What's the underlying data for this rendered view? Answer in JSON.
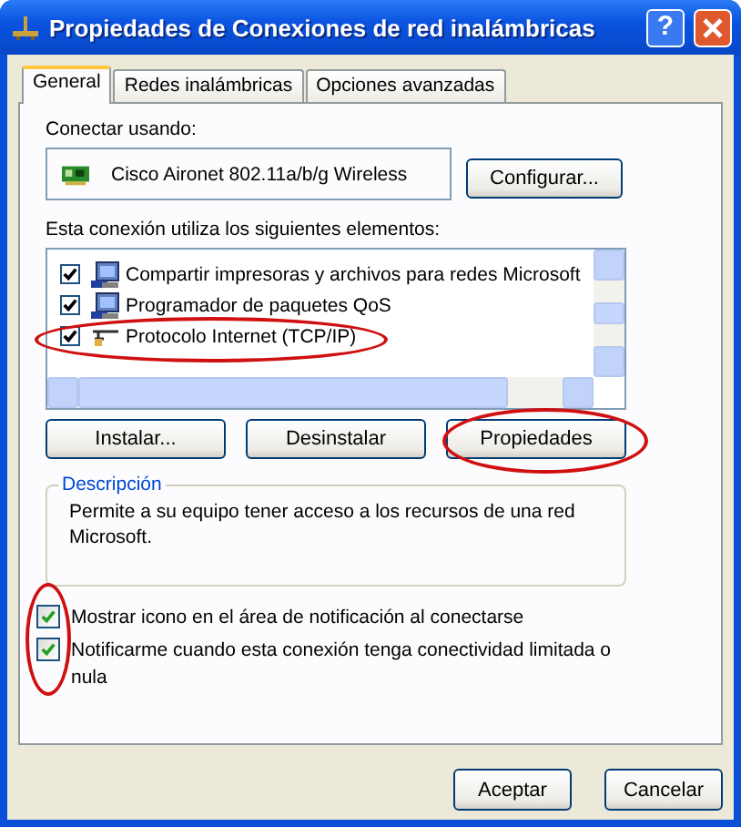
{
  "window": {
    "title": "Propiedades de Conexiones de red inalámbricas",
    "help_button": "?"
  },
  "tabs": [
    {
      "label": "General",
      "selected": true
    },
    {
      "label": "Redes inalámbricas",
      "selected": false
    },
    {
      "label": "Opciones avanzadas",
      "selected": false
    }
  ],
  "connect_using": {
    "label": "Conectar usando:",
    "device": "Cisco Aironet 802.11a/b/g Wireless",
    "button": "Configurar..."
  },
  "components": {
    "label": "Esta conexión utiliza los siguientes elementos:",
    "items": [
      {
        "kind": "computer",
        "label": "Compartir impresoras y archivos para redes Microsoft",
        "checked": true,
        "circled": false
      },
      {
        "kind": "computer",
        "label": "Programador de paquetes QoS",
        "checked": true,
        "circled": false
      },
      {
        "kind": "network",
        "label": "Protocolo Internet (TCP/IP)",
        "checked": true,
        "circled": true
      }
    ]
  },
  "item_buttons": [
    {
      "label": "Instalar...",
      "circled": false
    },
    {
      "label": "Desinstalar",
      "circled": false
    },
    {
      "label": "Propiedades",
      "circled": true
    }
  ],
  "description": {
    "title": "Descripción",
    "text": "Permite a su equipo tener acceso a los recursos de una red Microsoft."
  },
  "options": {
    "circled": true,
    "items": [
      {
        "label": "Mostrar icono en el área de notificación al conectarse",
        "checked": true
      },
      {
        "label": "Notificarme cuando esta conexión tenga conectividad limitada o nula",
        "checked": true
      }
    ]
  },
  "buttons": [
    "Aceptar",
    "Cancelar"
  ]
}
